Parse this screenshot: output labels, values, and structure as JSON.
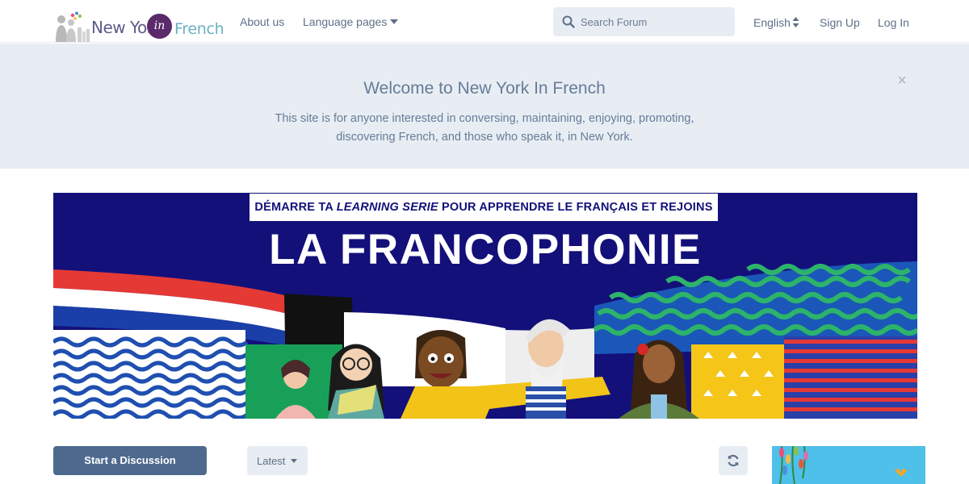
{
  "header": {
    "logo": {
      "part1": "New York",
      "badge": "in",
      "part2": "French"
    },
    "nav": {
      "about": "About us",
      "language_pages": "Language pages"
    },
    "search": {
      "placeholder": "Search Forum",
      "value": ""
    },
    "language": "English",
    "signup": "Sign Up",
    "login": "Log In"
  },
  "hero": {
    "title": "Welcome to New York In French",
    "description": "This site is for anyone interested in conversing, maintaining, enjoying, promoting, discovering French, and those who speak it, in New York.",
    "close": "×"
  },
  "banner": {
    "tagline_pre": "DÉMARRE TA ",
    "tagline_em": "LEARNING SERIE",
    "tagline_post": " POUR APPRENDRE LE FRANÇAIS ET REJOINS",
    "title": "LA FRANCOPHONIE"
  },
  "toolbar": {
    "start_discussion": "Start a Discussion",
    "sort": "Latest"
  },
  "colors": {
    "primary_button": "#4d698e",
    "hero_bg": "#e7edf3",
    "banner_bg": "#13107a"
  }
}
